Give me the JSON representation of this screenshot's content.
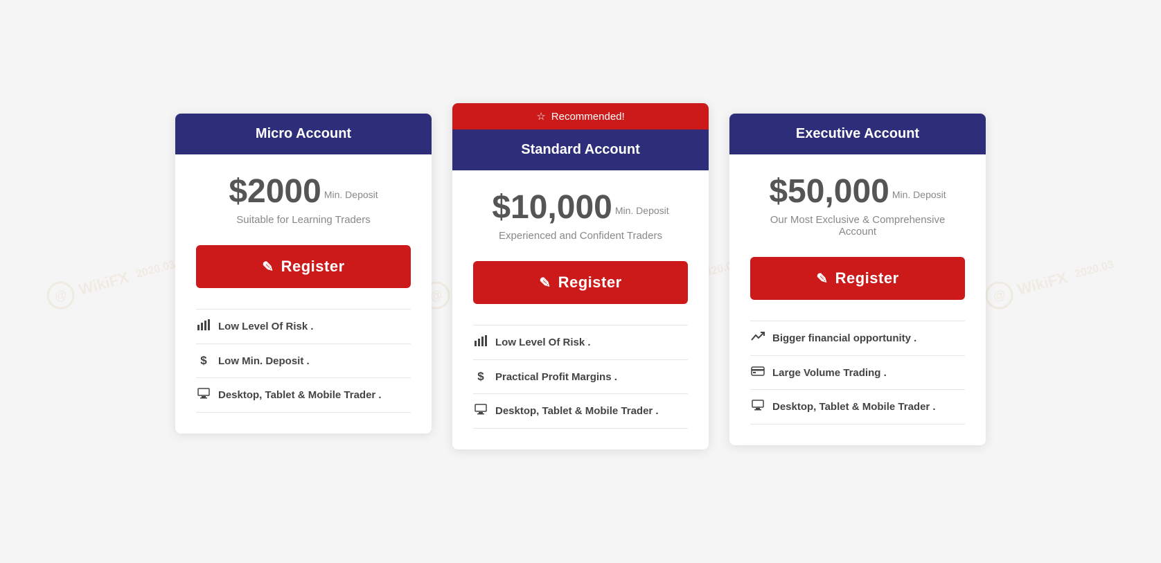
{
  "watermark": {
    "text": "WikiFX",
    "date": "2020.03"
  },
  "cards": [
    {
      "id": "micro",
      "header": "Micro Account",
      "recommended": false,
      "price": "$2000",
      "price_label": "Min. Deposit",
      "subtitle": "Suitable for Learning Traders",
      "register_label": "Register",
      "features": [
        {
          "icon": "chart",
          "text": "Low Level Of Risk ."
        },
        {
          "icon": "dollar",
          "text": "Low Min. Deposit ."
        },
        {
          "icon": "desktop",
          "text": "Desktop, Tablet & Mobile Trader ."
        }
      ]
    },
    {
      "id": "standard",
      "header": "Standard Account",
      "recommended": true,
      "recommended_label": "Recommended!",
      "price": "$10,000",
      "price_label": "Min. Deposit",
      "subtitle": "Experienced and Confident Traders",
      "register_label": "Register",
      "features": [
        {
          "icon": "chart",
          "text": "Low Level Of Risk ."
        },
        {
          "icon": "dollar",
          "text": "Practical Profit Margins ."
        },
        {
          "icon": "desktop",
          "text": "Desktop, Tablet & Mobile Trader ."
        }
      ]
    },
    {
      "id": "executive",
      "header": "Executive Account",
      "recommended": false,
      "price": "$50,000",
      "price_label": "Min. Deposit",
      "subtitle": "Our Most Exclusive & Comprehensive Account",
      "register_label": "Register",
      "features": [
        {
          "icon": "trend",
          "text": "Bigger financial opportunity ."
        },
        {
          "icon": "card",
          "text": "Large Volume Trading ."
        },
        {
          "icon": "desktop",
          "text": "Desktop, Tablet & Mobile Trader ."
        }
      ]
    }
  ],
  "icons": {
    "chart": "📊",
    "dollar": "$",
    "desktop": "🖥",
    "trend": "📈",
    "card": "💳",
    "pencil": "✎",
    "star": "☆"
  }
}
